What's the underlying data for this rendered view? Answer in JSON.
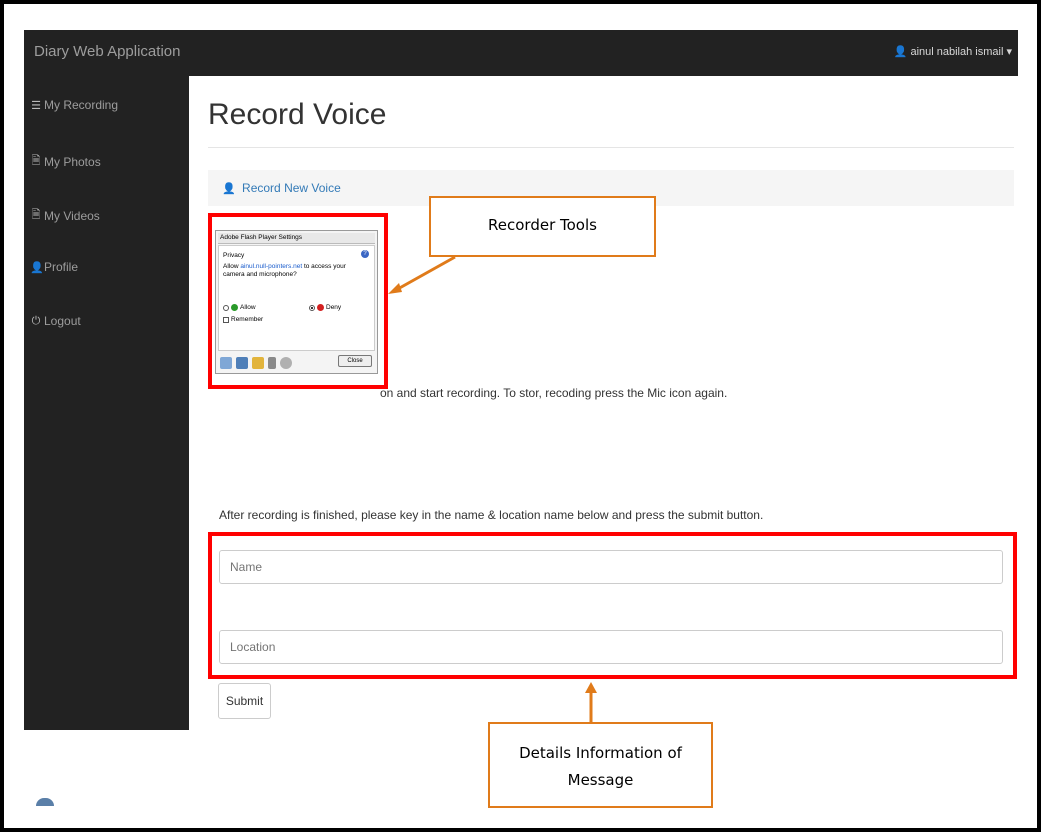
{
  "app": {
    "brand": "Diary Web Application"
  },
  "user": {
    "name": "ainul nabilah ismail",
    "icon": "user-icon",
    "caret": "▾"
  },
  "sidebar": {
    "items": [
      {
        "label": "My Recording",
        "icon": "list-icon",
        "glyph": "☰"
      },
      {
        "label": "My Photos",
        "icon": "file-icon",
        "glyph": "🗎"
      },
      {
        "label": "My Videos",
        "icon": "file-icon",
        "glyph": "🗎"
      },
      {
        "label": "Profile",
        "icon": "user-icon",
        "glyph": "👤"
      },
      {
        "label": "Logout",
        "icon": "power-icon",
        "glyph": "⏻"
      }
    ]
  },
  "main": {
    "title": "Record Voice",
    "panel_link": "Record New Voice",
    "record_instruction_visible": "on and start recording. To stor, recoding press the Mic icon again.",
    "after_instruction": "After recording is finished, please key in the name & location name below and press the submit button.",
    "name_placeholder": "Name",
    "location_placeholder": "Location",
    "submit_label": "Submit"
  },
  "flash_dialog": {
    "title": "Adobe Flash Player Settings",
    "section": "Privacy",
    "allow_prefix": "Allow ",
    "domain": "ainul.null-pointers.net",
    "allow_suffix": " to access your camera and microphone?",
    "allow_label": "Allow",
    "deny_label": "Deny",
    "remember_label": "Remember",
    "close_label": "Close",
    "help_glyph": "?"
  },
  "annotations": {
    "recorder_tools": "Recorder Tools",
    "details_line1": "Details Information of",
    "details_line2": "Message"
  },
  "colors": {
    "navbar": "#222222",
    "highlight_red": "#ff0000",
    "callout_orange": "#e07b1a",
    "link_blue": "#337ab7"
  }
}
